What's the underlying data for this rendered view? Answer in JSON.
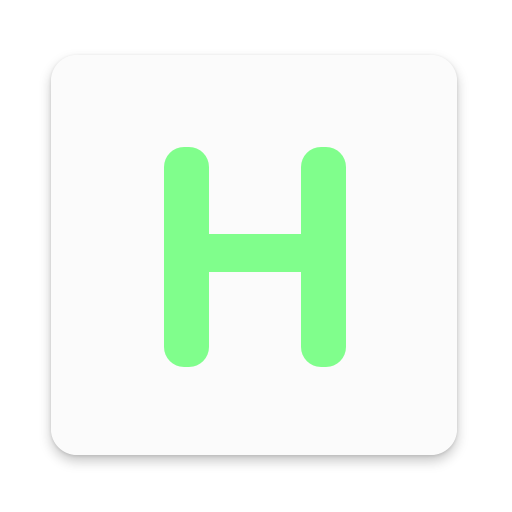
{
  "icon": {
    "name": "letter-h-app-icon",
    "letter": "H",
    "colors": {
      "tile": "#fbfbfb",
      "glyph": "#80fe8c",
      "page": "#ffffff"
    }
  }
}
